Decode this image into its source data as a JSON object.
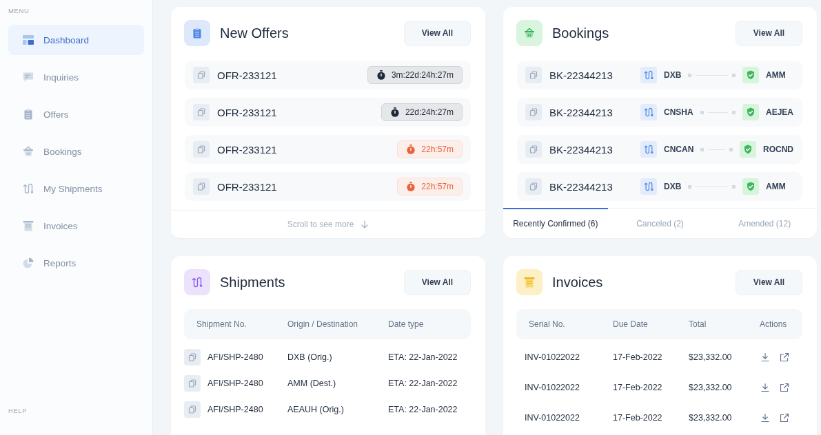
{
  "sidebar": {
    "menu_label": "MENU",
    "items": [
      {
        "label": "Dashboard",
        "selected": true
      },
      {
        "label": "Inquiries",
        "selected": false
      },
      {
        "label": "Offers",
        "selected": false
      },
      {
        "label": "Bookings",
        "selected": false
      },
      {
        "label": "My Shipments",
        "selected": false
      },
      {
        "label": "Invoices",
        "selected": false
      },
      {
        "label": "Reports",
        "selected": false
      }
    ],
    "help_label": "HELP"
  },
  "new_offers": {
    "title": "New Offers",
    "button": "View All",
    "rows": [
      {
        "id": "OFR-233121",
        "countdown": "3m:22d:24h:27m",
        "color": "#1e293b"
      },
      {
        "id": "OFR-233121",
        "countdown": "22d:24h:27m",
        "color": "#1e293b"
      },
      {
        "id": "OFR-233121",
        "countdown": "22h:57m",
        "color": "#e8623a"
      },
      {
        "id": "OFR-233121",
        "countdown": "22h:57m",
        "color": "#e8623a"
      }
    ],
    "footer": "Scroll to see more"
  },
  "bookings": {
    "title": "Bookings",
    "button": "View All",
    "rows": [
      {
        "id": "BK-22344213",
        "origin": "DXB",
        "destination": "AMM"
      },
      {
        "id": "BK-22344213",
        "origin": "CNSHA",
        "destination": "AEJEA"
      },
      {
        "id": "BK-22344213",
        "origin": "CNCAN",
        "destination": "ROCND"
      },
      {
        "id": "BK-22344213",
        "origin": "DXB",
        "destination": "AMM"
      }
    ],
    "tabs": [
      {
        "label": "Recently Confirmed (6)",
        "selected": true
      },
      {
        "label": "Canceled (2)",
        "selected": false
      },
      {
        "label": "Amended (12)",
        "selected": false
      }
    ]
  },
  "shipments": {
    "title": "Shipments",
    "button": "View All",
    "columns": [
      "Shipment No.",
      "Origin / Destination",
      "Date type"
    ],
    "rows": [
      [
        "AFI/SHP-2480",
        "DXB (Orig.)",
        "ETA: 22-Jan-2022"
      ],
      [
        "AFI/SHP-2480",
        "AMM (Dest.)",
        "ETA: 22-Jan-2022"
      ],
      [
        "AFI/SHP-2480",
        "AEAUH (Orig.)",
        "ETA: 22-Jan-2022"
      ]
    ]
  },
  "invoices": {
    "title": "Invoices",
    "button": "View All",
    "columns": [
      "Serial No.",
      "Due Date",
      "Total",
      "Actions"
    ],
    "rows": [
      [
        "INV-01022022",
        "17-Feb-2022",
        "$23,332.00"
      ],
      [
        "INV-01022022",
        "17-Feb-2022",
        "$23,332.00"
      ],
      [
        "INV-01022022",
        "17-Feb-2022",
        "$23,332.00"
      ]
    ]
  }
}
